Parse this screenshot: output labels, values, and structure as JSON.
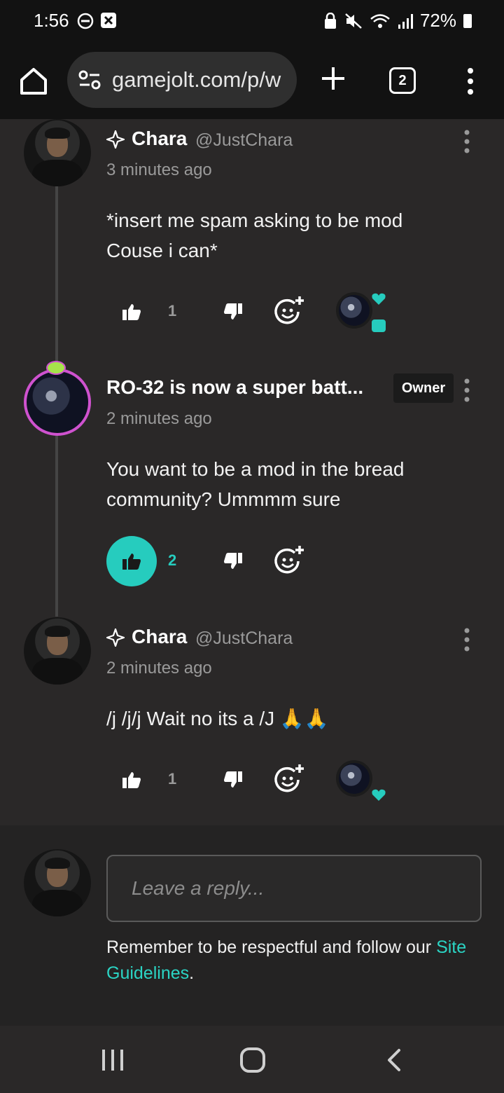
{
  "status_bar": {
    "time": "1:56",
    "battery": "72%"
  },
  "browser": {
    "url": "gamejolt.com/p/w",
    "tab_count": "2"
  },
  "comments": [
    {
      "name": "Chara",
      "handle": "@JustChara",
      "time": "3 minutes ago",
      "body_lines": [
        "*insert me spam asking to be mod",
        "Couse i can*"
      ],
      "likes": "1",
      "liked": false
    },
    {
      "name": "RO-32 is now a super batt...",
      "badge": "Owner",
      "time": "2 minutes ago",
      "body_lines": [
        "You want to be a mod in the bread",
        "community? Ummmm sure"
      ],
      "likes": "2",
      "liked": true
    },
    {
      "name": "Chara",
      "handle": "@JustChara",
      "time": "2 minutes ago",
      "body_lines": [
        "/j /j/j Wait no its a /J 🙏🙏"
      ],
      "likes": "1",
      "liked": false
    }
  ],
  "reply": {
    "placeholder": "Leave a reply...",
    "notice": "Remember to be respectful and follow our ",
    "link": "Site Guidelines",
    "notice_end": "."
  },
  "colors": {
    "accent": "#26ccbe",
    "owner_ring": "#cf52cf",
    "background": "#2a2828"
  }
}
